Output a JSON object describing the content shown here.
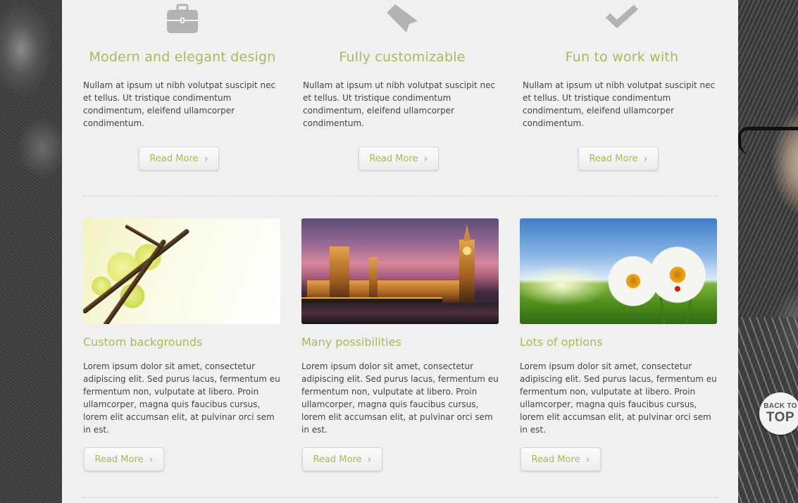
{
  "features": [
    {
      "icon": "briefcase-icon",
      "title": "Modern and elegant design",
      "text": "Nullam at ipsum ut nibh volutpat suscipit nec et tellus. Ut tristique condimentum condimentum, eleifend ullamcorper condimentum.",
      "button": "Read More"
    },
    {
      "icon": "ribbon-tag-icon",
      "title": "Fully customizable",
      "text": "Nullam at ipsum ut nibh volutpat suscipit nec et tellus. Ut tristique condimentum condimentum, eleifend ullamcorper condimentum.",
      "button": "Read More"
    },
    {
      "icon": "checkmark-icon",
      "title": "Fun to work with",
      "text": "Nullam at ipsum ut nibh volutpat suscipit nec et tellus. Ut tristique condimentum condimentum, eleifend ullamcorper condimentum.",
      "button": "Read More"
    }
  ],
  "cards": [
    {
      "image": "orchid-photo",
      "title": "Custom backgrounds",
      "text": "Lorem ipsum dolor sit amet, consectetur adipiscing elit. Sed purus lacus, fermentum eu fermentum non, vulputate at libero. Proin ullamcorper, magna quis faucibus cursus, lorem elit accumsan elit, at pulvinar orci sem in est.",
      "button": "Read More"
    },
    {
      "image": "london-parliament-photo",
      "title": "Many possibilities",
      "text": "Lorem ipsum dolor sit amet, consectetur adipiscing elit. Sed purus lacus, fermentum eu fermentum non, vulputate at libero. Proin ullamcorper, magna quis faucibus cursus, lorem elit accumsan elit, at pulvinar orci sem in est.",
      "button": "Read More"
    },
    {
      "image": "daisies-photo",
      "title": "Lots of options",
      "text": "Lorem ipsum dolor sit amet, consectetur adipiscing elit. Sed purus lacus, fermentum eu fermentum non, vulputate at libero. Proin ullamcorper, magna quis faucibus cursus, lorem elit accumsan elit, at pulvinar orci sem in est.",
      "button": "Read More"
    }
  ],
  "back_to_top": {
    "line1": "BACK TO",
    "line2": "TOP"
  },
  "colors": {
    "accent": "#a4bc5c",
    "panel": "#f0f0f0",
    "text": "#444444",
    "icon": "#b3b3b3"
  }
}
